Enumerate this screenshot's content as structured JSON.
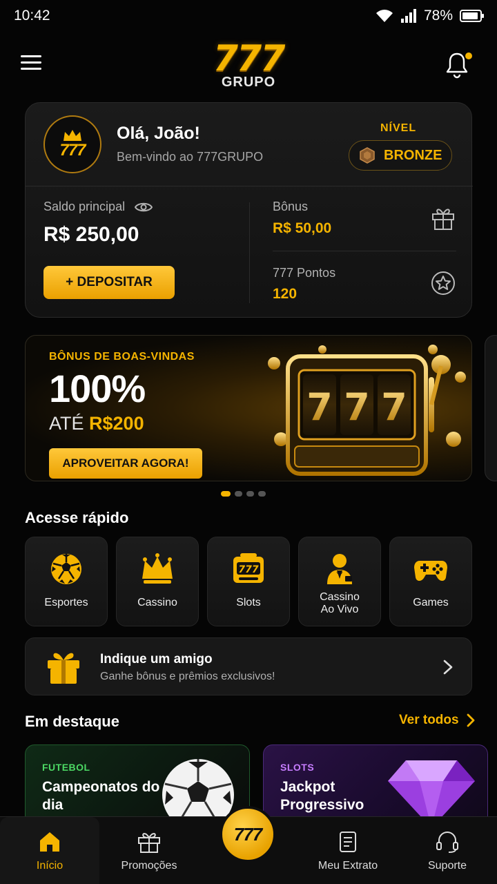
{
  "status_bar": {
    "time": "10:42",
    "battery": "78%"
  },
  "header": {
    "logo_number": "777",
    "logo_text": "GRUPO"
  },
  "account": {
    "avatar_text": "777",
    "greeting": "Olá, João!",
    "welcome": "Bem-vindo ao 777GRUPO",
    "level_label": "NÍVEL",
    "level_value": "BRONZE",
    "balance_label": "Saldo principal",
    "balance_value": "R$ 250,00",
    "deposit_label": "+ DEPOSITAR",
    "bonus_label": "Bônus",
    "bonus_value": "R$ 50,00",
    "points_label": "777 Pontos",
    "points_value": "120"
  },
  "promo": {
    "title": "BÔNUS DE BOAS-VINDAS",
    "big": "100%",
    "sub_prefix": "ATÉ",
    "sub_amount": "R$200",
    "button": "APROVEITAR AGORA!",
    "slides": 4,
    "active_slide": 1,
    "reel_symbol": "7"
  },
  "quick_access": {
    "title": "Acesse rápido",
    "items": [
      {
        "label": "Esportes",
        "icon": "soccer-ball-icon"
      },
      {
        "label": "Cassino",
        "icon": "crown-icon"
      },
      {
        "label": "Slots",
        "icon": "slot-777-icon"
      },
      {
        "label": "Cassino\nAo Vivo",
        "icon": "dealer-icon"
      },
      {
        "label": "Games",
        "icon": "gamepad-icon"
      }
    ]
  },
  "refer": {
    "title": "Indique um amigo",
    "subtitle": "Ganhe bônus e prêmios exclusivos!"
  },
  "featured": {
    "title": "Em destaque",
    "see_all": "Ver todos",
    "cards": [
      {
        "tag": "FUTEBOL",
        "title": "Campeonatos do dia",
        "tag_color": "#4cd964"
      },
      {
        "tag": "SLOTS",
        "title": "Jackpot Progressivo",
        "tag_color": "#c77dff"
      }
    ]
  },
  "bottom_nav": {
    "items": [
      {
        "label": "Início",
        "icon": "home-icon"
      },
      {
        "label": "Promoções",
        "icon": "gift-icon"
      },
      {
        "label": "777",
        "icon": "center-777-icon"
      },
      {
        "label": "Meu Extrato",
        "icon": "receipt-icon"
      },
      {
        "label": "Suporte",
        "icon": "headset-icon"
      }
    ]
  },
  "colors": {
    "accent": "#f5b400",
    "background": "#050505",
    "card": "#161616"
  }
}
